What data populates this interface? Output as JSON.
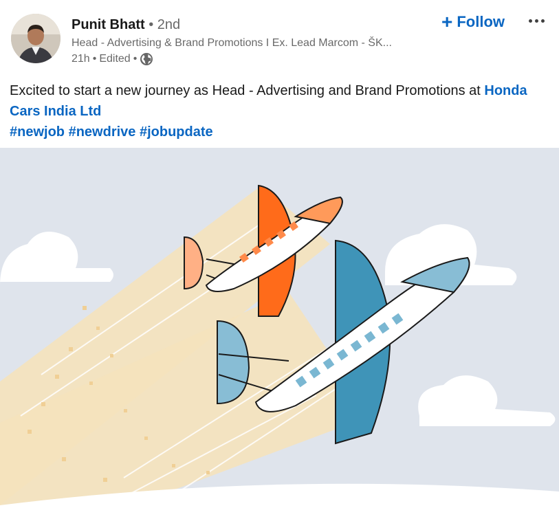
{
  "author": {
    "name": "Punit Bhatt",
    "degree_sep": " • ",
    "degree": "2nd",
    "headline": "Head - Advertising & Brand Promotions I Ex. Lead Marcom - ŠK...",
    "time": "21h",
    "edited": "Edited",
    "visibility_icon": "globe-icon"
  },
  "actions": {
    "follow_label": "Follow",
    "follow_icon": "+",
    "more_icon": "ellipsis-icon"
  },
  "post": {
    "text_before": "Excited to start a new journey as Head - Advertising and Brand Promotions at ",
    "company_link": "Honda Cars India Ltd",
    "hashtags": [
      "#newjob",
      "#newdrive",
      "#jobupdate"
    ]
  },
  "colors": {
    "link": "#0a66c2",
    "sky": "#dfe4ec",
    "trail": "#f5e2bd",
    "orange": "#ff6b1a",
    "blue": "#3f94b8"
  }
}
